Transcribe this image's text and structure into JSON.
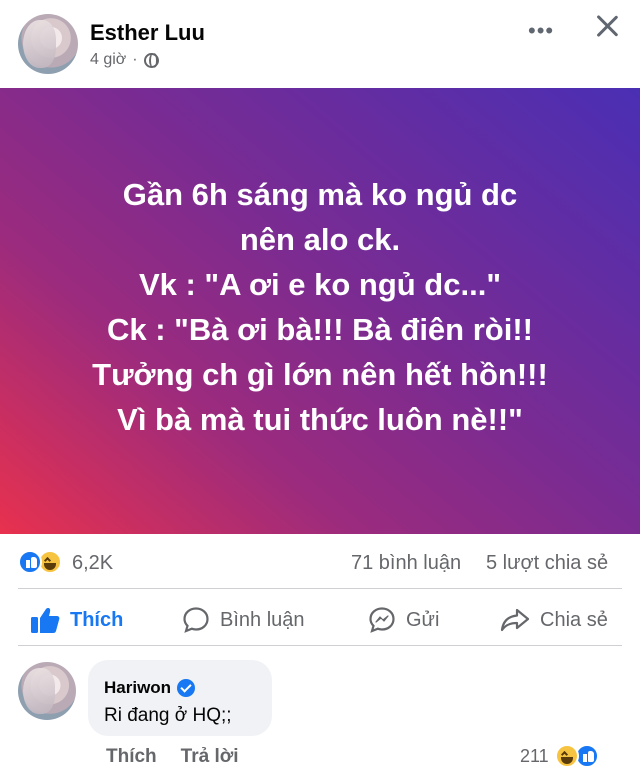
{
  "post": {
    "author": "Esther Luu",
    "time": "4 giờ",
    "separator": "·",
    "more_label": "•••",
    "privacy_icon": "globe-icon",
    "text_lines": [
      "Gần 6h sáng mà ko ngủ dc",
      "nên alo ck.",
      "Vk : \"A ơi e ko ngủ dc...\"",
      "Ck : \"Bà ơi bà!!! Bà điên ròi!!",
      "Tưởng ch gì lớn nên hết hồn!!!",
      "Vì bà mà tui thức luôn nè!!\""
    ],
    "background_colors": [
      "#e8314e",
      "#7a2b92",
      "#4a2fb4"
    ]
  },
  "stats": {
    "reactions": "6,2K",
    "comments": "71 bình luận",
    "shares": "5 lượt chia sẻ"
  },
  "actions": {
    "like": "Thích",
    "comment": "Bình luận",
    "send": "Gửi",
    "share": "Chia sẻ"
  },
  "comment": {
    "author": "Hariwon",
    "text": "Ri đang ở HQ;;",
    "like_label": "Thích",
    "reply_label": "Trả lời",
    "reactions": "211"
  },
  "colors": {
    "accent": "#1877f2",
    "secondary_text": "#65676b",
    "bubble": "#f0f2f5"
  }
}
